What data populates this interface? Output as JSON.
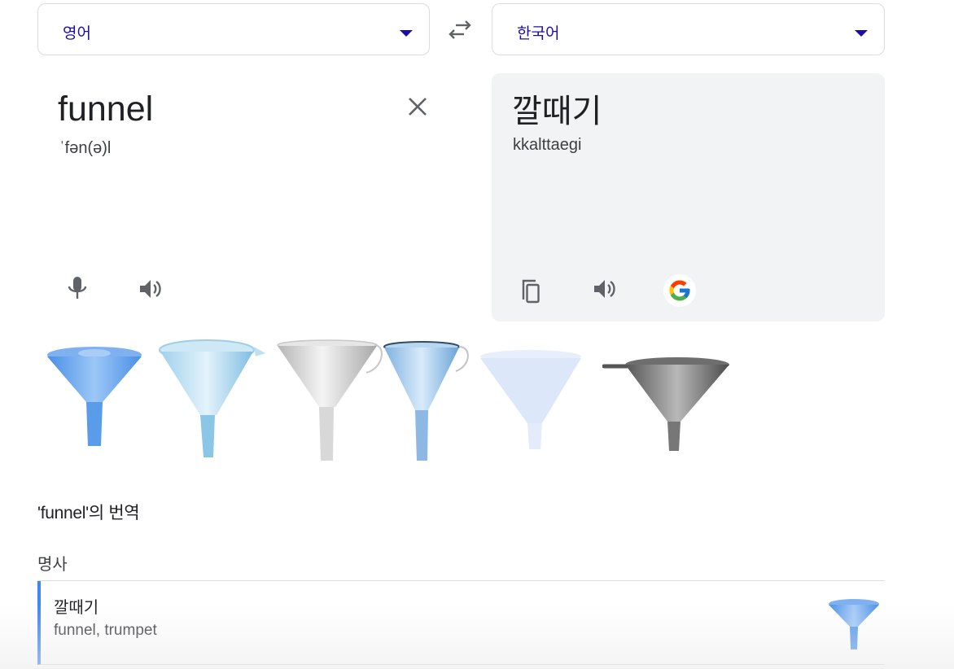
{
  "source_lang": {
    "label": "영어"
  },
  "target_lang": {
    "label": "한국어"
  },
  "source": {
    "text": "funnel",
    "phonetic": "ˈfən(ə)l"
  },
  "target": {
    "text": "깔때기",
    "romanization": "kkalttaegi"
  },
  "translations": {
    "title": "'funnel'의 번역",
    "pos": "명사",
    "entries": [
      {
        "word": "깔때기",
        "synonyms": "funnel, trumpet"
      }
    ]
  },
  "icons": {
    "dropdown": "chevron-down-icon",
    "swap": "swap-icon",
    "clear": "close-icon",
    "mic": "microphone-icon",
    "speaker": "speaker-icon",
    "copy": "copy-icon",
    "google": "google-logo-icon"
  },
  "colors": {
    "accent": "#1a0dab",
    "entry_border": "#4285f4",
    "panel_bg": "#f1f3f4",
    "funnel_blue": "#5b9bea"
  }
}
